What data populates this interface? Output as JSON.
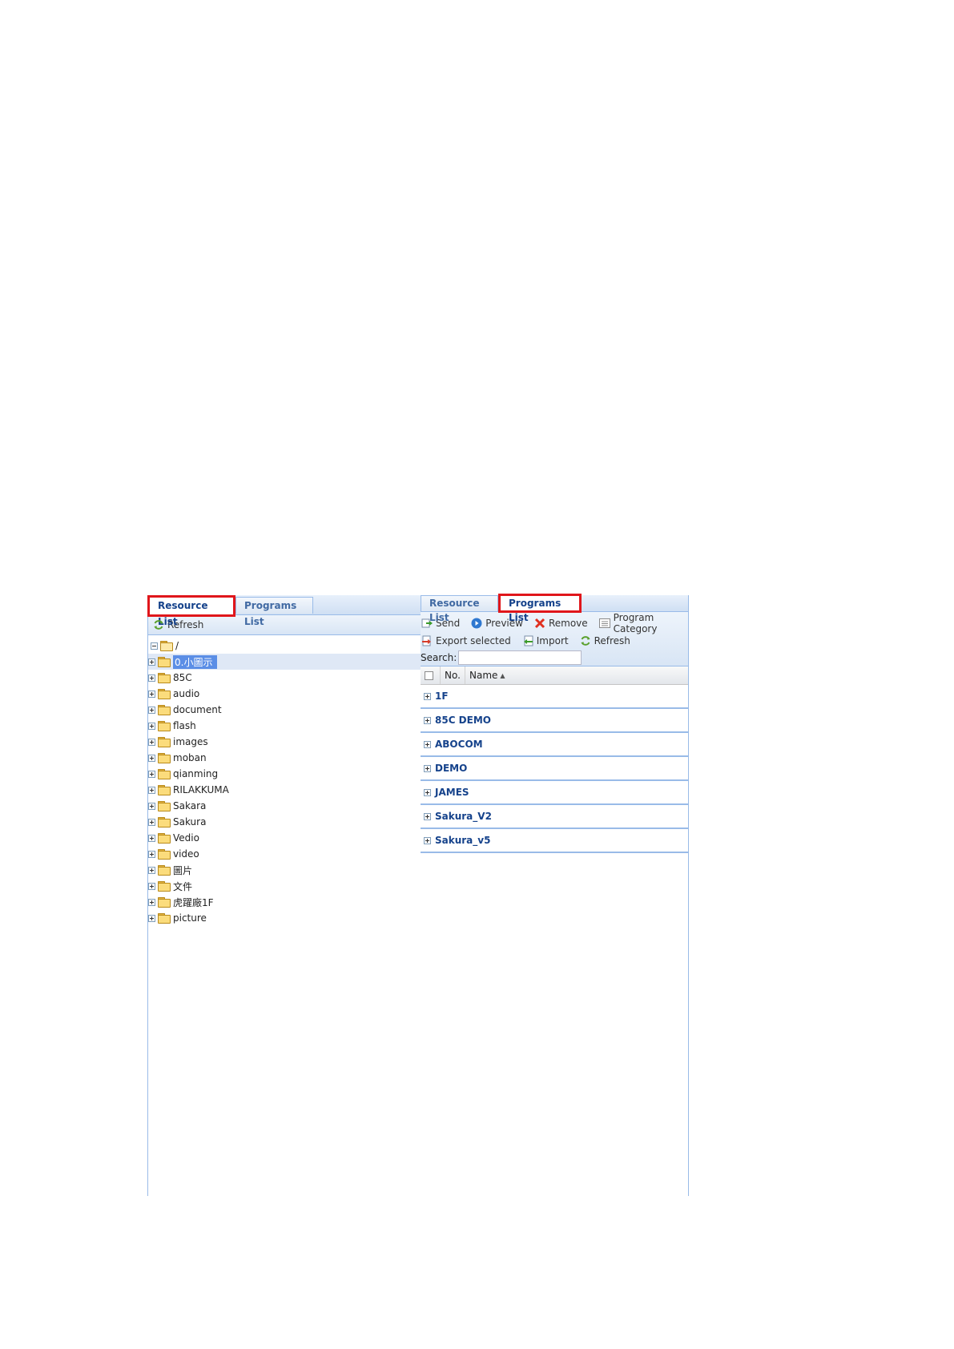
{
  "left_panel": {
    "tabs": [
      {
        "label": "Resource List",
        "active": true,
        "highlighted": true
      },
      {
        "label": "Programs List",
        "active": false,
        "highlighted": false
      }
    ],
    "toolbar": {
      "refresh_label": "Refresh",
      "refresh_icon": "refresh-icon"
    },
    "tree": {
      "root_label": "/",
      "items": [
        {
          "label": "0.小圖示",
          "selected": true
        },
        {
          "label": "85C"
        },
        {
          "label": "audio"
        },
        {
          "label": "document"
        },
        {
          "label": "flash"
        },
        {
          "label": "images"
        },
        {
          "label": "moban"
        },
        {
          "label": "qianming"
        },
        {
          "label": "RILAKKUMA"
        },
        {
          "label": "Sakara"
        },
        {
          "label": "Sakura"
        },
        {
          "label": "Vedio"
        },
        {
          "label": "video"
        },
        {
          "label": "圖片"
        },
        {
          "label": "文件"
        },
        {
          "label": "虎躍廠1F"
        },
        {
          "label": "picture"
        }
      ]
    }
  },
  "right_panel": {
    "tabs": [
      {
        "label": "Resource List",
        "active": false,
        "highlighted": false
      },
      {
        "label": "Programs List",
        "active": true,
        "highlighted": true
      }
    ],
    "toolbar": {
      "send_label": "Send",
      "preview_label": "Preview",
      "remove_label": "Remove",
      "category_label": "Program Category",
      "export_label": "Export selected",
      "import_label": "Import",
      "refresh_label": "Refresh"
    },
    "search": {
      "label": "Search:",
      "value": ""
    },
    "grid": {
      "columns": [
        "No.",
        "Name"
      ],
      "groups": [
        "1F",
        "85C DEMO",
        "ABOCOM",
        "DEMO",
        "JAMES",
        "Sakura_V2",
        "Sakura_v5"
      ]
    }
  },
  "colors": {
    "highlight_border": "#e0161b",
    "panel_border": "#99bbe8",
    "selected_node": "#5b8ee6",
    "group_text": "#15428b"
  }
}
